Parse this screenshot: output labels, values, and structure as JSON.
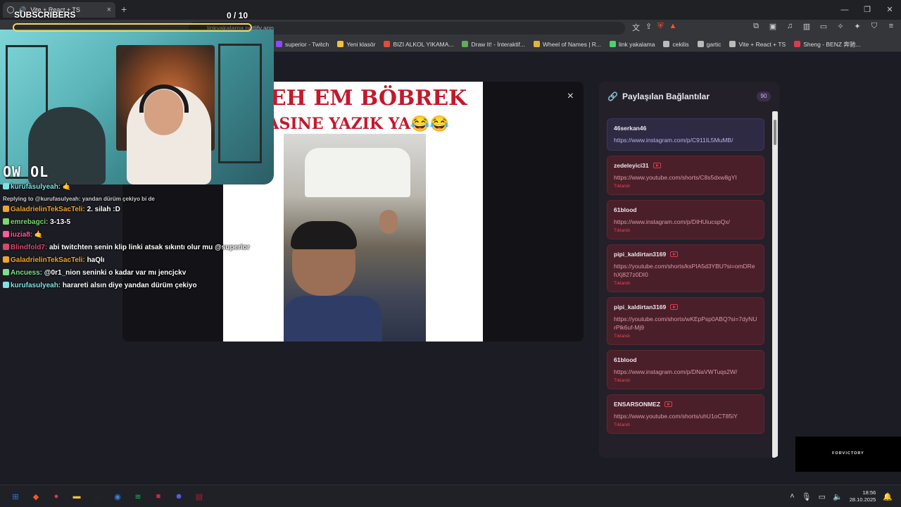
{
  "browser": {
    "tab_title": "Vite + React + TS",
    "tab_close": "×",
    "new_tab": "+",
    "url": "linkyakalama.netlify.app",
    "window_controls": {
      "minimize": "—",
      "maximize": "❐",
      "close": "✕"
    }
  },
  "bookmarks": [
    {
      "label": "superior - Twitch",
      "color": "#9146ff"
    },
    {
      "label": "Yeni klasör",
      "color": "#f0c33c"
    },
    {
      "label": "BIZI ALKOL YIKAMA...",
      "color": "#e34b3a"
    },
    {
      "label": "Draw It! - İnteraktif...",
      "color": "#5fae54"
    },
    {
      "label": "Wheel of Names | R...",
      "color": "#e0b63a"
    },
    {
      "label": "link yakalama",
      "color": "#4ad36a"
    },
    {
      "label": "cekilis",
      "color": "#bbbbbb"
    },
    {
      "label": "gartic",
      "color": "#bbbbbb"
    },
    {
      "label": "Vite + React + TS",
      "color": "#bbbbbb"
    },
    {
      "label": "Sheng - BENZ 奔驰...",
      "color": "#e0384f"
    }
  ],
  "overlay": {
    "subs_label": "SUBSCRIBERS",
    "subs_count": "0  / 10",
    "subs_progress": 0,
    "webcam_logo": "OW OL",
    "sponsor": "FORVICTORY"
  },
  "chat": {
    "reply_line": "Replying to @kurufasulyeah: yandan dürüm çekiyo bi de",
    "lines": [
      {
        "user": "kurufasulyeah:",
        "color": "#7fe3e3",
        "text": "🤙"
      },
      {
        "user": "GaladrielinTekSacTeli:",
        "color": "#f0a52a",
        "text": "2. silah :D"
      },
      {
        "user": "emrebagci:",
        "color": "#7bd86b",
        "text": "3-13-5"
      },
      {
        "user": "iuzia8:",
        "color": "#ff5a9a",
        "text": "🤙"
      },
      {
        "user": "Blindfold7:",
        "color": "#d44a6a",
        "text": "abi twitchten senin klip linki atsak sıkıntı olur mu @superior"
      },
      {
        "user": "GaladrielinTekSacTeli:",
        "color": "#f0a52a",
        "text": "haQlı"
      },
      {
        "user": "Ancuess:",
        "color": "#7fe08c",
        "text": "@0r1_nion seninki o kadar var mı jencjckv"
      },
      {
        "user": "kurufasulyeah:",
        "color": "#7fe3e3",
        "text": "harareti alsın diye yandan dürüm çekiyo"
      }
    ]
  },
  "modal": {
    "close_label": "×",
    "caption_line1": "ELEH EM BÖBREK",
    "caption_line2": "YASINE YAZIK YA😂😂"
  },
  "panel": {
    "title": "Paylaşılan Bağlantılar",
    "count": "90",
    "entries": [
      {
        "user": "46serkan46",
        "url": "https://www.instagram.com/p/C911IL5MuMB/",
        "status": "",
        "youtube": false,
        "active": true
      },
      {
        "user": "zedeleyici31",
        "url": "https://www.youtube.com/shorts/C8s5dxw8gYI",
        "status": "Tıklandı",
        "youtube": true,
        "active": false
      },
      {
        "user": "61blood",
        "url": "https://www.instagram.com/p/DIHUiucspQx/",
        "status": "Tıklandı",
        "youtube": false,
        "active": false
      },
      {
        "user": "pipi_kaldirtan3169",
        "url": "https://youtube.com/shorts/ksPIA5d3YBU?si=omDRehXj827z0DI0",
        "status": "Tıklandı",
        "youtube": true,
        "active": false
      },
      {
        "user": "pipi_kaldirtan3169",
        "url": "https://youtube.com/shorts/wKEpPsp0ABQ?si=7dyNUrPlk6uf-Mj9",
        "status": "Tıklandı",
        "youtube": true,
        "active": false
      },
      {
        "user": "61blood",
        "url": "https://www.instagram.com/p/DNaVWTuqs2W/",
        "status": "Tıklandı",
        "youtube": false,
        "active": false
      },
      {
        "user": "ENSARSONMEZ",
        "url": "https://www.youtube.com/shorts/uhU1oCT85iY",
        "status": "Tıklandı",
        "youtube": true,
        "active": false
      }
    ]
  },
  "taskbar": {
    "time": "18:56",
    "date": "28.10.2025",
    "apps": [
      {
        "icon": "windows-icon",
        "glyph": "⊞",
        "color": "#2a7fd8"
      },
      {
        "icon": "brave-icon",
        "glyph": "◆",
        "color": "#fb542b"
      },
      {
        "icon": "maps-pin-icon",
        "glyph": "●",
        "color": "#e0384f"
      },
      {
        "icon": "folder-icon",
        "glyph": "▬",
        "color": "#f0c33c"
      },
      {
        "icon": "steam-icon",
        "glyph": "◎",
        "color": "#1b2838"
      },
      {
        "icon": "sphere-icon",
        "glyph": "◉",
        "color": "#3a82d8"
      },
      {
        "icon": "spotify-icon",
        "glyph": "≋",
        "color": "#1db954"
      },
      {
        "icon": "red-app-icon",
        "glyph": "■",
        "color": "#c8283a"
      },
      {
        "icon": "discord-icon",
        "glyph": "☻",
        "color": "#5865f2"
      },
      {
        "icon": "red-badge-icon",
        "glyph": "▤",
        "color": "#b0202e"
      }
    ]
  }
}
